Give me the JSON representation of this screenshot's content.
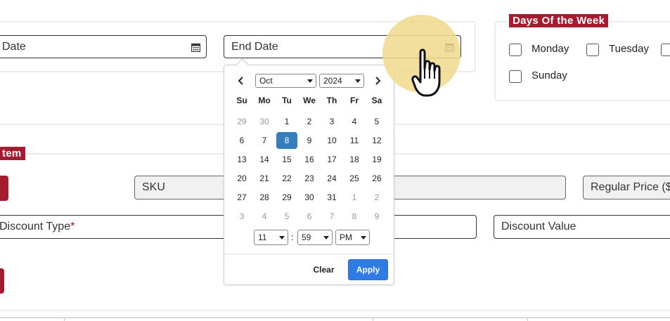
{
  "form": {
    "start_date_placeholder": "Date",
    "end_date_placeholder": "End Date",
    "days_legend": "Days Of the Week",
    "days": [
      {
        "label": "Monday",
        "checked": false
      },
      {
        "label": "Tuesday",
        "checked": false
      },
      {
        "label": "Sunday",
        "checked": false
      }
    ],
    "item_legend": "tem",
    "sku_placeholder": "SKU",
    "regular_price_placeholder": "Regular Price ($)",
    "discount_type_label": "Discount Type",
    "required_mark": "*",
    "discount_value_placeholder": "Discount Value"
  },
  "picker": {
    "month": "Oct",
    "year": "2024",
    "weekdays": [
      "Su",
      "Mo",
      "Tu",
      "We",
      "Th",
      "Fr",
      "Sa"
    ],
    "weeks": [
      [
        "29",
        "30",
        "1",
        "2",
        "3",
        "4",
        "5"
      ],
      [
        "6",
        "7",
        "8",
        "9",
        "10",
        "11",
        "12"
      ],
      [
        "13",
        "14",
        "15",
        "16",
        "17",
        "18",
        "19"
      ],
      [
        "20",
        "21",
        "22",
        "23",
        "24",
        "25",
        "26"
      ],
      [
        "27",
        "28",
        "29",
        "30",
        "31",
        "1",
        "2"
      ],
      [
        "3",
        "4",
        "5",
        "6",
        "7",
        "8",
        "9"
      ]
    ],
    "hour": "11",
    "time_separator": ":",
    "minute": "59",
    "ampm": "PM",
    "clear_label": "Clear",
    "apply_label": "Apply",
    "prev_icon": "chevron-left-icon",
    "next_icon": "chevron-right-icon"
  },
  "colors": {
    "brand_red": "#a51c30",
    "selected_day": "#357ebd",
    "apply_button": "#2f7be5",
    "cursor_highlight": "#f0d98c"
  }
}
